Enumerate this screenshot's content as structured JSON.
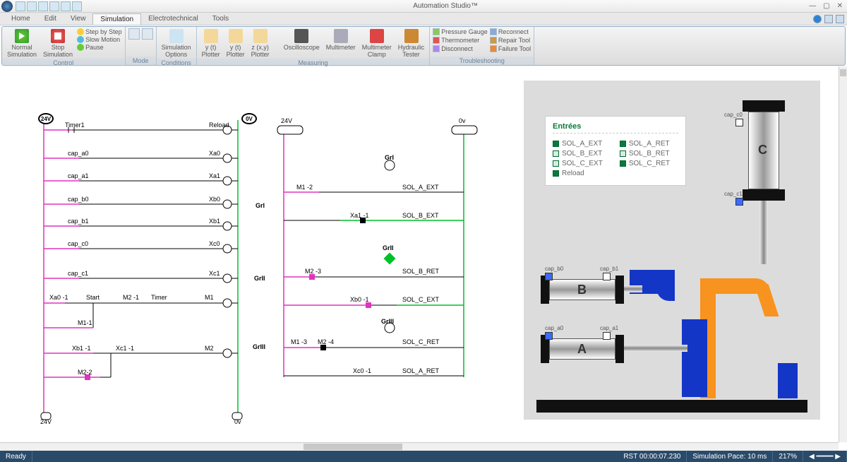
{
  "app": {
    "title": "Automation Studio™"
  },
  "qat_items": [
    "new",
    "open",
    "save",
    "undo",
    "redo",
    "print",
    "help"
  ],
  "tabs": {
    "home": "Home",
    "edit": "Edit",
    "view": "View",
    "simulation": "Simulation",
    "electro": "Electrotechnical",
    "tools": "Tools"
  },
  "ribbon": {
    "control": {
      "label": "Control",
      "normal": "Normal\nSimulation",
      "stop": "Stop\nSimulation",
      "step": "Step by Step",
      "slow": "Slow Motion",
      "pause": "Pause"
    },
    "mode": {
      "label": "Mode"
    },
    "conditions": {
      "label": "Conditions",
      "simopts": "Simulation\nOptions"
    },
    "measuring": {
      "label": "Measuring",
      "yt": "y (t)\nPlotter",
      "zt": "y (t)\nPlotter",
      "xy": "z (x,y)\nPlotter",
      "osc": "Oscilloscope",
      "mm": "Multimeter",
      "clamp": "Multimeter\nClamp",
      "hyd": "Hydraulic\nTester"
    },
    "troubleshooting": {
      "label": "Troubleshooting",
      "pg": "Pressure Gauge",
      "th": "Thermometer",
      "dc": "Disconnect",
      "rc": "Reconnect",
      "rt": "Repair Tool",
      "ft": "Failure Tool"
    }
  },
  "circuit": {
    "v24": "24V",
    "v0": "0V",
    "timer1": "Timer1",
    "reload": "Reload",
    "cap_a0": "cap_a0",
    "cap_a1": "cap_a1",
    "cap_b0": "cap_b0",
    "cap_b1": "cap_b1",
    "cap_c0": "cap_c0",
    "cap_c1": "cap_c1",
    "xa0": "Xa0",
    "xa1": "Xa1",
    "xb0": "Xb0",
    "xb1": "Xb1",
    "xc0": "Xc0",
    "xc1": "Xc1",
    "xa0_1": "Xa0 -1",
    "start": "Start",
    "m2_1": "M2 -1",
    "timer": "Timer",
    "m1": "M1",
    "m1_1": "M1-1",
    "xb1_1": "Xb1 -1",
    "xc1_1": "Xc1 -1",
    "m2": "M2",
    "m2_2": "M2-2",
    "v24_bot": "24V",
    "v0_bot": "0v",
    "grl": "GrI",
    "grll": "GrII",
    "grlll": "GrIII",
    "r24v": "24V",
    "r0v": "0v",
    "rm1_2": "M1 -2",
    "rxa1_1": "Xa1 -1",
    "rm2_3": "M2 -3",
    "rxb0_1": "Xb0 -1",
    "rm1_3": "M1 -3",
    "rm2_4": "M2 -4",
    "rxc0_1": "Xc0 -1",
    "sol_a_ext": "SOL_A_EXT",
    "sol_b_ext": "SOL_B_EXT",
    "sol_b_ret": "SOL_B_RET",
    "sol_c_ext": "SOL_C_EXT",
    "sol_c_ret": "SOL_C_RET",
    "sol_a_ret": "SOL_A_RET",
    "rgrl": "GrI",
    "rgrll": "GrII",
    "rgrlll": "GrIII"
  },
  "entries": {
    "title": "Entrées",
    "left": [
      "SOL_A_EXT",
      "SOL_B_EXT",
      "SOL_C_EXT",
      "Reload"
    ],
    "right": [
      "SOL_A_RET",
      "SOL_B_RET",
      "SOL_C_RET"
    ],
    "left_on": [
      true,
      false,
      false,
      true
    ],
    "right_on": [
      true,
      false,
      true
    ]
  },
  "sensors": {
    "cap_c0": "cap_c0",
    "cap_c1": "cap_c1",
    "cap_b0": "cap_b0",
    "cap_b1": "cap_b1",
    "cap_a0": "cap_a0",
    "cap_a1": "cap_a1"
  },
  "cylinders": {
    "a": "A",
    "b": "B",
    "c": "C"
  },
  "status": {
    "ready": "Ready",
    "rst": "RST 00:00:07.230",
    "pace": "Simulation Pace: 10 ms",
    "zoom": "217%"
  }
}
